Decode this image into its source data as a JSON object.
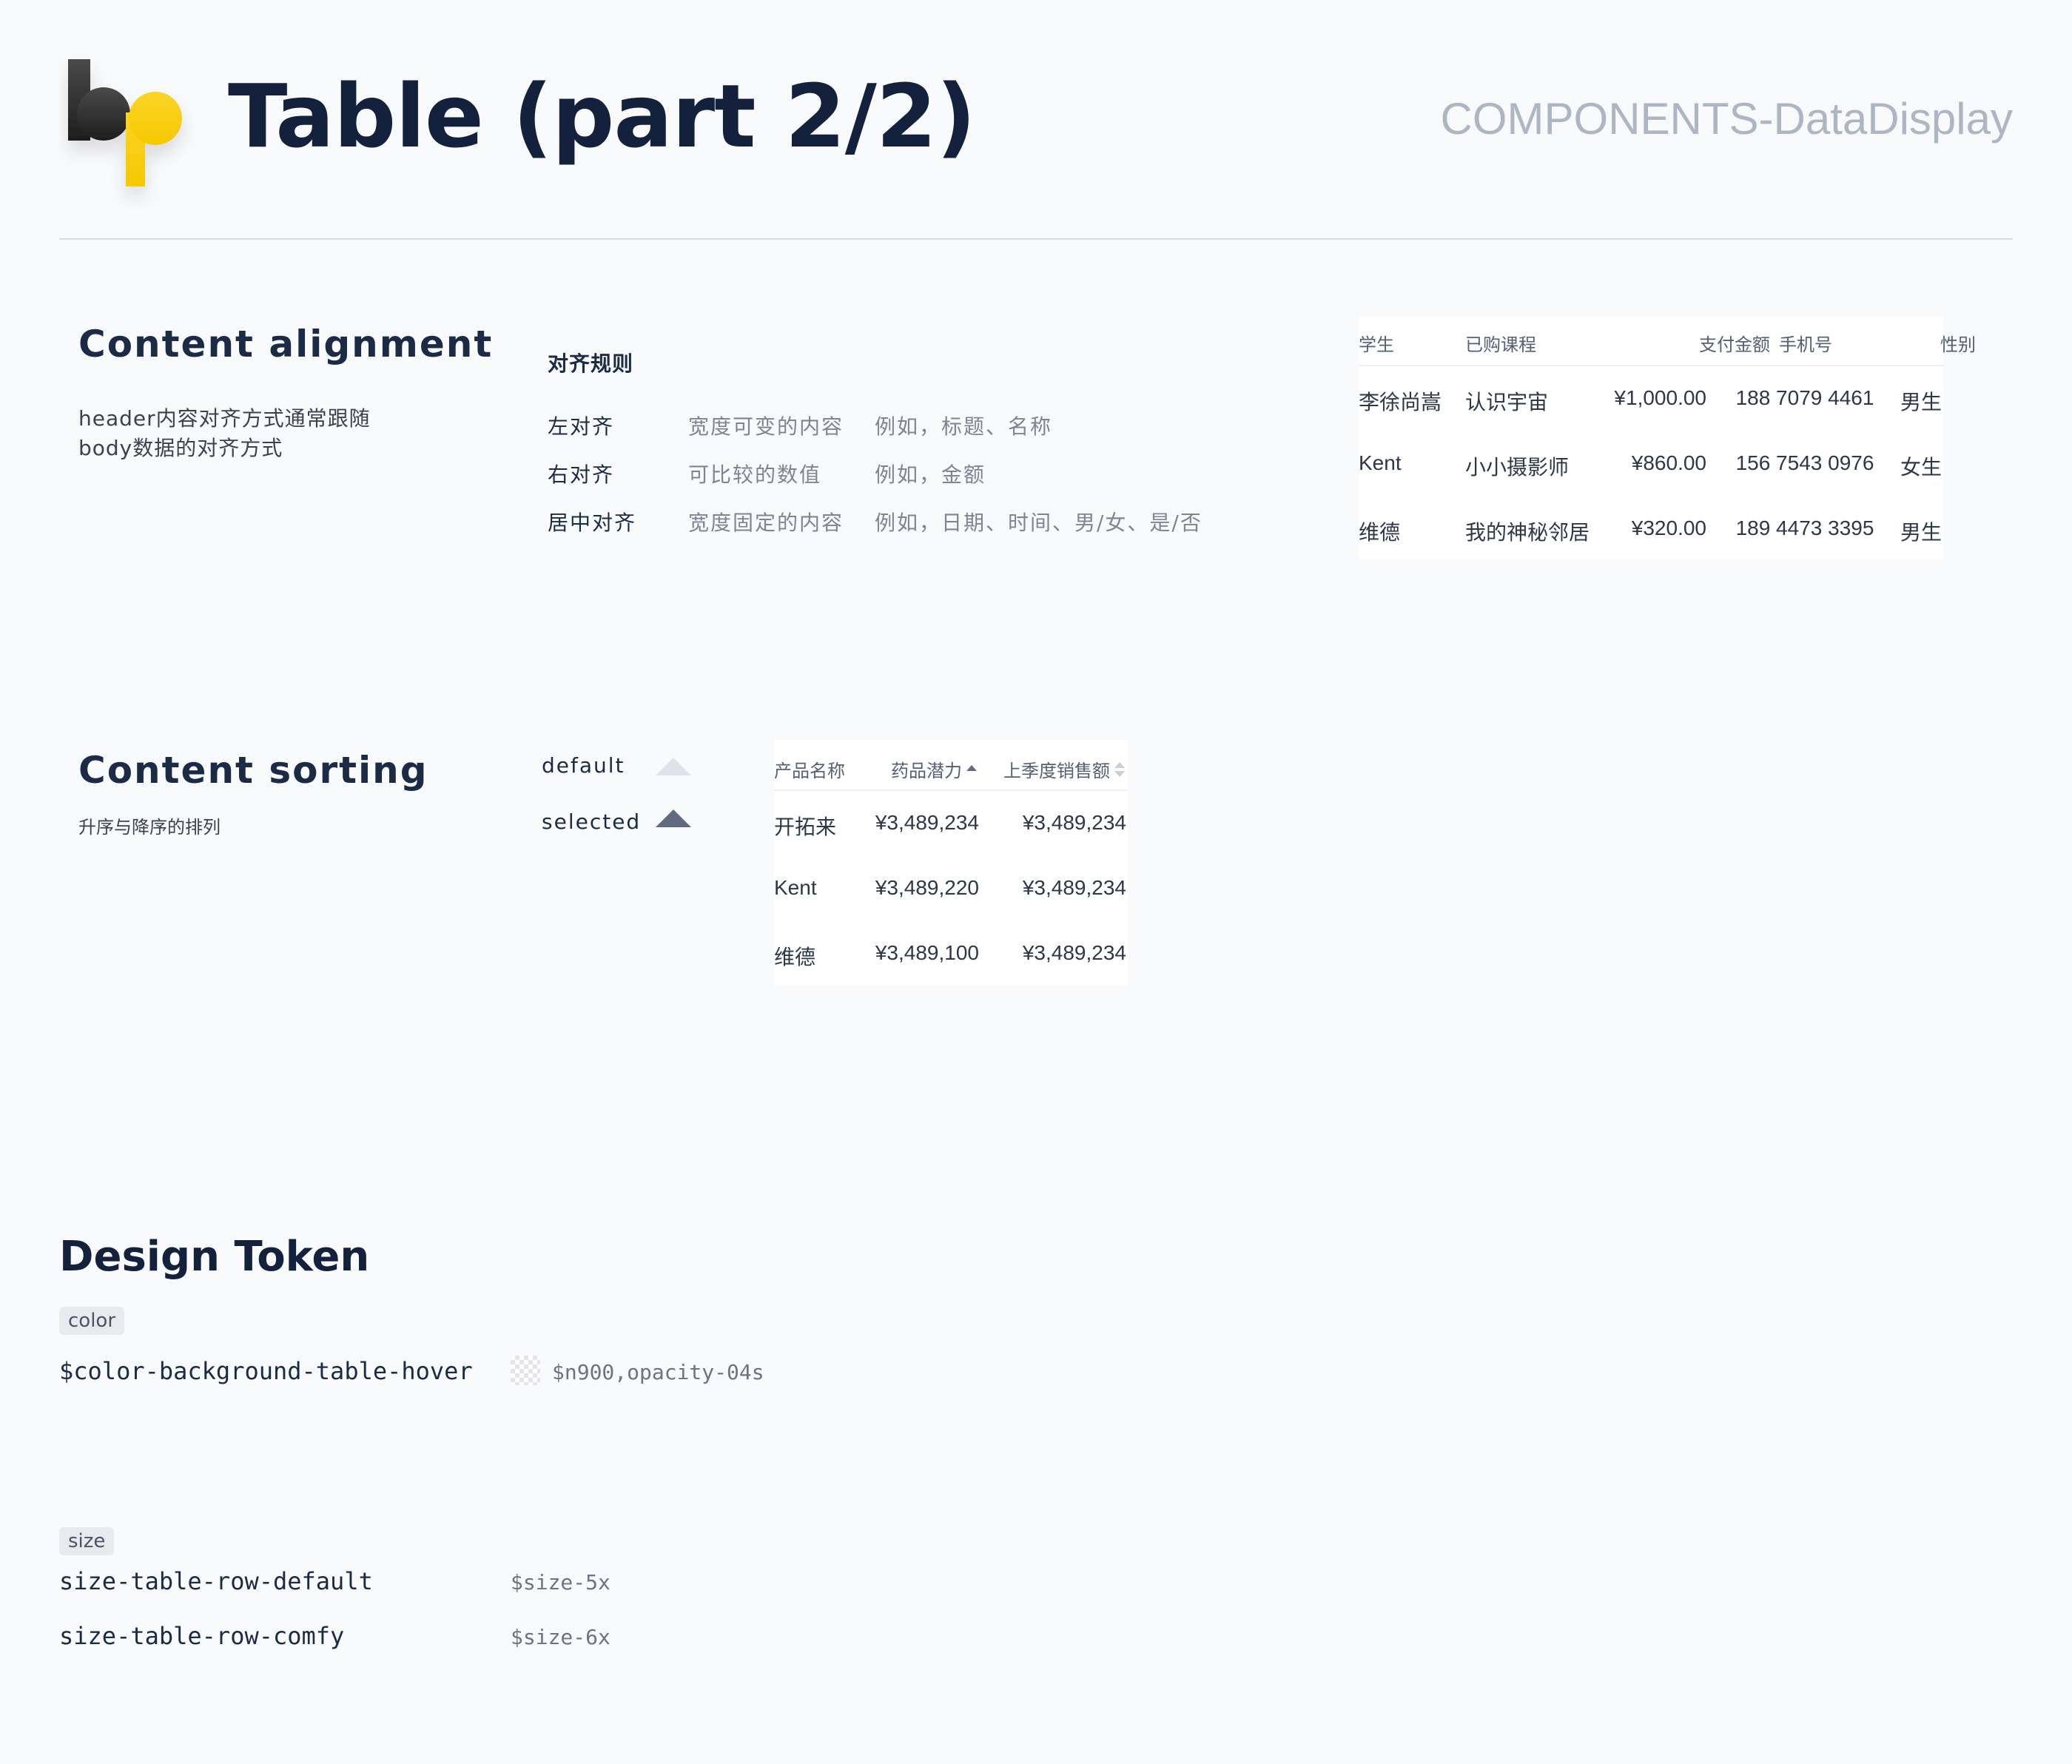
{
  "header": {
    "title": "Table (part 2/2)",
    "category": "COMPONENTS-DataDisplay",
    "logo_icon": "bp-logo-icon"
  },
  "alignment": {
    "title": "Content alignment",
    "desc_line1": "header内容对齐方式通常跟随",
    "desc_line2": "body数据的对齐方式",
    "rules_heading": "对齐规则",
    "rules": [
      {
        "name": "左对齐",
        "desc": "宽度可变的内容",
        "example": "例如，标题、名称"
      },
      {
        "name": "右对齐",
        "desc": "可比较的数值",
        "example": "例如，金额"
      },
      {
        "name": "居中对齐",
        "desc": "宽度固定的内容",
        "example": "例如，日期、时间、男/女、是/否"
      }
    ],
    "table": {
      "columns": [
        "学生",
        "已购课程",
        "支付金额",
        "手机号",
        "性别"
      ],
      "rows": [
        [
          "李徐尚嵩",
          "认识宇宙",
          "¥1,000.00",
          "188 7079 4461",
          "男生"
        ],
        [
          "Kent",
          "小小摄影师",
          "¥860.00",
          "156 7543 0976",
          "女生"
        ],
        [
          "维德",
          "我的神秘邻居",
          "¥320.00",
          "189 4473 3395",
          "男生"
        ]
      ]
    }
  },
  "sorting": {
    "title": "Content sorting",
    "desc": "升序与降序的排列",
    "default_label": "default",
    "selected_label": "selected",
    "table": {
      "columns": [
        "产品名称",
        "药品潜力",
        "上季度销售额"
      ],
      "rows": [
        [
          "开拓来",
          "¥3,489,234",
          "¥3,489,234"
        ],
        [
          "Kent",
          "¥3,489,220",
          "¥3,489,234"
        ],
        [
          "维德",
          "¥3,489,100",
          "¥3,489,234"
        ]
      ]
    }
  },
  "design_token": {
    "title": "Design Token",
    "color_chip": "color",
    "color_tokens": [
      {
        "name": "$color-background-table-hover",
        "value": "$n900,opacity-04s"
      }
    ],
    "size_chip": "size",
    "size_tokens": [
      {
        "name": "size-table-row-default",
        "value": "$size-5x"
      },
      {
        "name": "size-table-row-comfy",
        "value": "$size-6x"
      }
    ]
  },
  "colors": {
    "background": "#f9fafc",
    "title": "#14213d",
    "category": "#aeb5c3",
    "logo_dark": "#2b2b2b",
    "logo_yellow": "#f7cf17",
    "sort_selected": "#616b7f",
    "sort_default": "#dfe2e8"
  }
}
